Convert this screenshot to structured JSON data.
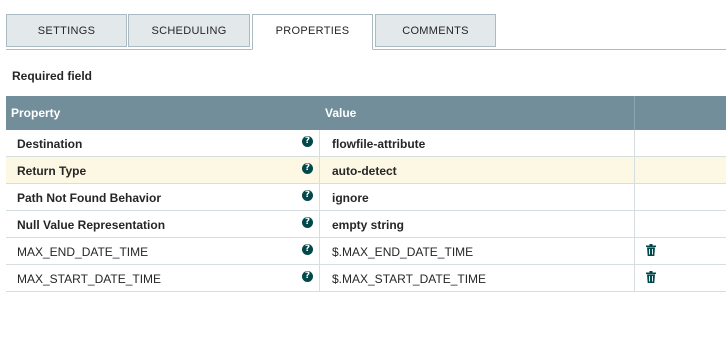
{
  "tabs": {
    "settings": "SETTINGS",
    "scheduling": "SCHEDULING",
    "properties": "PROPERTIES",
    "comments": "COMMENTS"
  },
  "required_label": "Required field",
  "table": {
    "headers": {
      "property": "Property",
      "value": "Value"
    },
    "rows": [
      {
        "name": "Destination",
        "value": "flowfile-attribute",
        "required": true
      },
      {
        "name": "Return Type",
        "value": "auto-detect",
        "required": true,
        "highlighted": true
      },
      {
        "name": "Path Not Found Behavior",
        "value": "ignore",
        "required": true
      },
      {
        "name": "Null Value Representation",
        "value": "empty string",
        "required": true
      },
      {
        "name": "MAX_END_DATE_TIME",
        "value": "$.MAX_END_DATE_TIME",
        "required": false,
        "deletable": true
      },
      {
        "name": "MAX_START_DATE_TIME",
        "value": "$.MAX_START_DATE_TIME",
        "required": false,
        "deletable": true
      }
    ]
  },
  "icons": {
    "help": "help-circle-icon",
    "delete": "trash-icon"
  },
  "colors": {
    "header_bg": "#728e9b",
    "tab_bg": "#e3e8eb",
    "highlight_row": "#fdf8e4",
    "icon_color": "#004849"
  }
}
